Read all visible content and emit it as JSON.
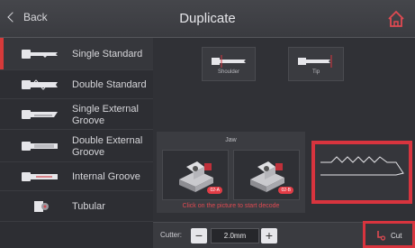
{
  "header": {
    "back_label": "Back",
    "title": "Duplicate"
  },
  "sidebar": {
    "items": [
      {
        "label": "Single Standard",
        "active": true
      },
      {
        "label": "Double Standard",
        "active": false
      },
      {
        "label": "Single External\nGroove",
        "active": false
      },
      {
        "label": "Double External\nGroove",
        "active": false
      },
      {
        "label": "Internal Groove",
        "active": false
      },
      {
        "label": "Tubular",
        "active": false
      }
    ]
  },
  "positioning": {
    "shoulder_label": "Shoulder",
    "tip_label": "Tip"
  },
  "jaw": {
    "title": "Jaw",
    "left_badge": "02-A",
    "right_badge": "02-B",
    "hint": "Click on the picture to start decode"
  },
  "cutter": {
    "label": "Cutter:",
    "minus": "−",
    "value": "2.0mm",
    "plus": "+"
  },
  "cut_button": {
    "label": "Cut"
  },
  "colors": {
    "accent_red": "#d8343e",
    "background": "#2b2c31"
  }
}
